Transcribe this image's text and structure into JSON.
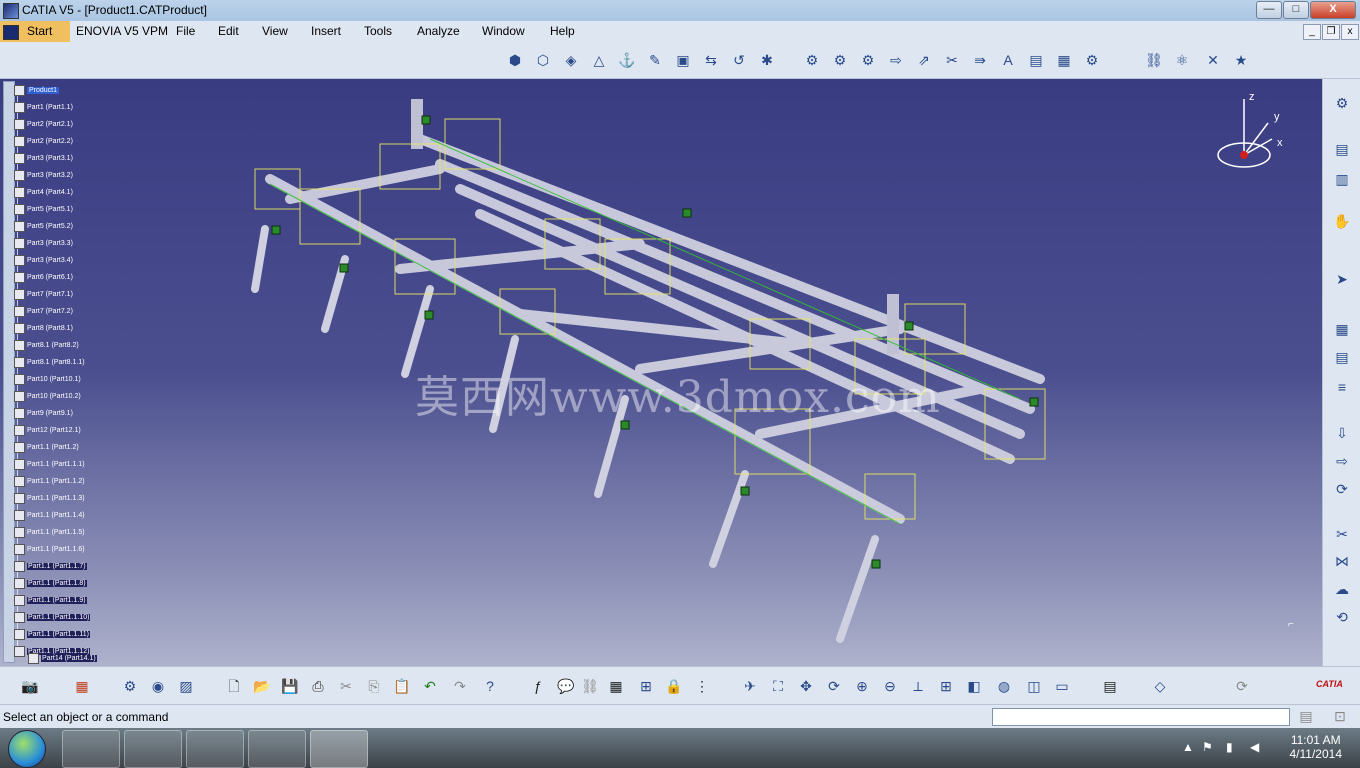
{
  "window": {
    "title": "CATIA V5 - [Product1.CATProduct]",
    "minimize": "—",
    "maximize": "□",
    "close": "X"
  },
  "menubar": {
    "start": "Start",
    "items": [
      "ENOVIA V5 VPM",
      "File",
      "Edit",
      "View",
      "Insert",
      "Tools",
      "Analyze",
      "Window",
      "Help"
    ],
    "mdi_min": "_",
    "mdi_restore": "❐",
    "mdi_close": "x"
  },
  "tree": {
    "root": "Product1",
    "items": [
      "Part1 (Part1.1)",
      "Part2 (Part2.1)",
      "Part2 (Part2.2)",
      "Part3 (Part3.1)",
      "Part3 (Part3.2)",
      "Part4 (Part4.1)",
      "Part5 (Part5.1)",
      "Part5 (Part5.2)",
      "Part3 (Part3.3)",
      "Part3 (Part3.4)",
      "Part6 (Part6.1)",
      "Part7 (Part7.1)",
      "Part7 (Part7.2)",
      "Part8 (Part8.1)",
      "Part8.1 (Part8.2)",
      "Part8.1 (Part8.1.1)",
      "Part10 (Part10.1)",
      "Part10 (Part10.2)",
      "Part9 (Part9.1)",
      "Part12 (Part12.1)",
      "Part1.1 (Part1.2)",
      "Part1.1 (Part1.1.1)",
      "Part1.1 (Part1.1.2)",
      "Part1.1 (Part1.1.3)",
      "Part1.1 (Part1.1.4)",
      "Part1.1 (Part1.1.5)",
      "Part1.1 (Part1.1.6)",
      "Part1.1 (Part1.1.7)",
      "Part1.1 (Part1.1.8)",
      "Part1.1 (Part1.1.9)",
      "Part1.1 (Part1.1.10)",
      "Part1.1 (Part1.1.11)",
      "Part1.1 (Part1.1.12)",
      "Part14 (Part14.1)"
    ]
  },
  "viewport": {
    "watermark": "莫西网www.3dmox.com",
    "compass_labels": {
      "z": "z",
      "y": "y",
      "x": "x"
    }
  },
  "status": {
    "text": "Select an object or a command"
  },
  "brand": {
    "logo": "CATIA"
  },
  "taskbar": {
    "time": "11:01 AM",
    "date": "4/11/2014"
  },
  "colors": {
    "viewport_top": "#3a3c82",
    "viewport_bottom": "#aeb2cc",
    "model": "#d8d8e4",
    "constraint": "#e8e860",
    "anchor": "#2a8a2a"
  }
}
